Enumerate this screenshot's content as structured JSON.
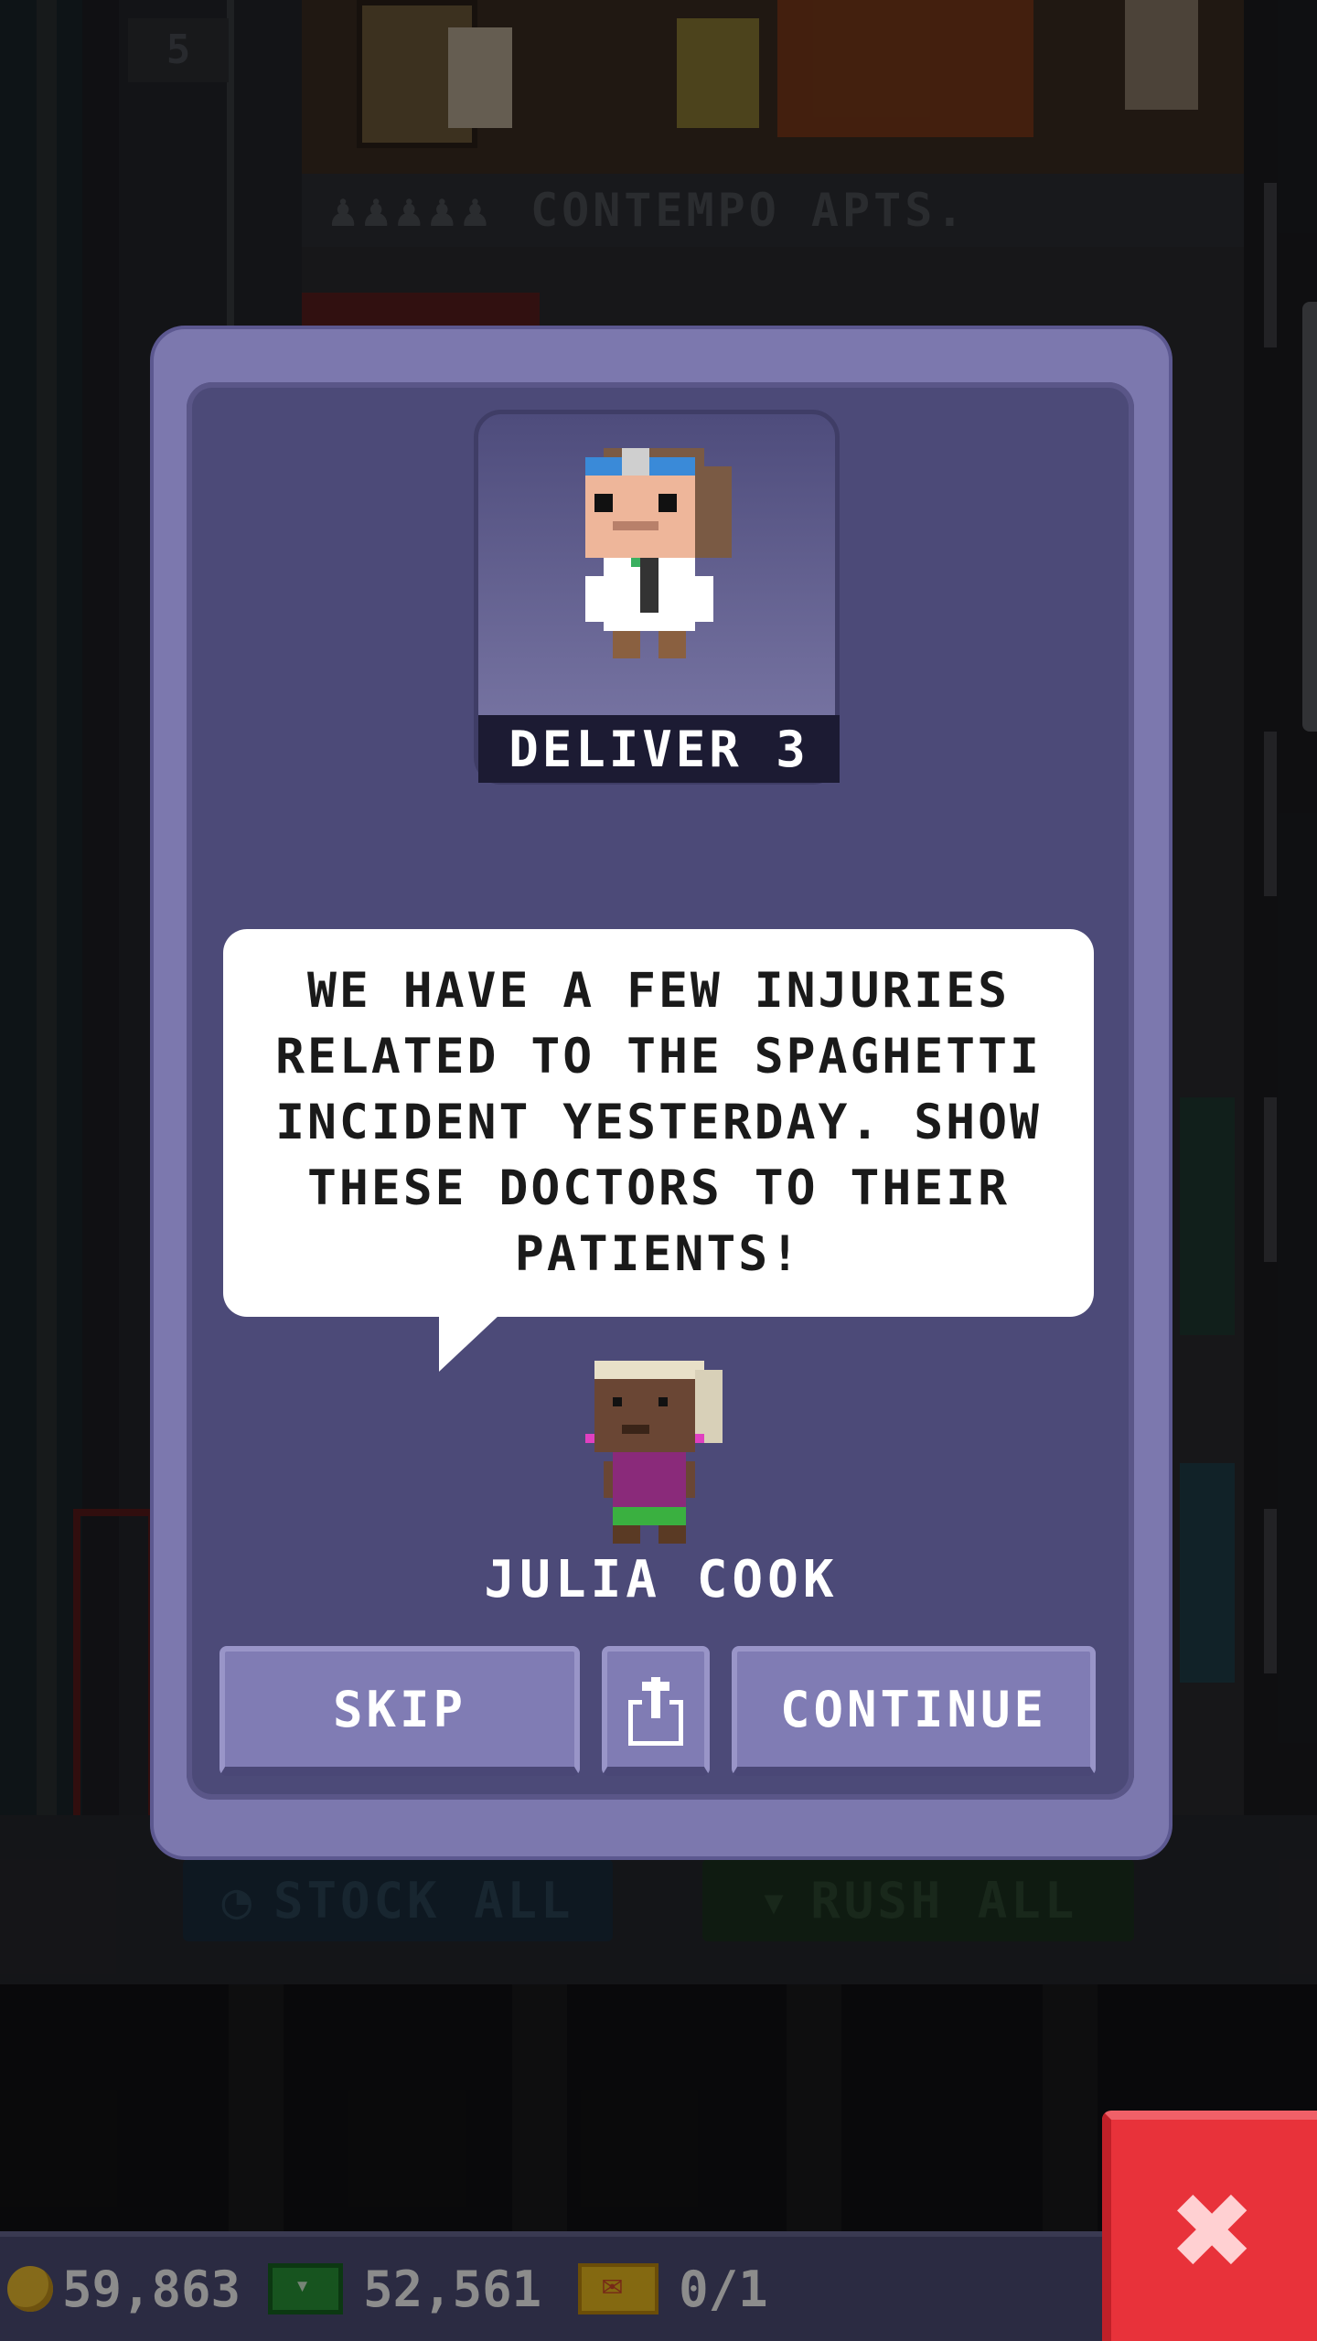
{
  "background": {
    "floor_number": "5",
    "floor_name": "CONTEMPO APTS.",
    "stock_all_label": "STOCK ALL",
    "rush_all_label": "RUSH ALL"
  },
  "dialog": {
    "task_label": "DELIVER 3",
    "message": "WE HAVE A FEW INJURIES RELATED TO THE SPAGHETTI INCIDENT YESTERDAY. SHOW THESE DOCTORS TO THEIR PATIENTS!",
    "speaker_name": "JULIA COOK",
    "buttons": {
      "skip": "SKIP",
      "continue": "CONTINUE"
    }
  },
  "currency": {
    "coins": "59,863",
    "bux": "52,561",
    "tickets": "0/1"
  },
  "colors": {
    "dialog_outer": "#7c78ae",
    "dialog_inner": "#4c4a78",
    "button": "#807cb4",
    "close_button": "#e8323a",
    "currency_bar": "#4f4f78"
  },
  "icons": {
    "share": "share-icon",
    "close": "close-icon",
    "coin": "coin-icon",
    "bux": "bux-icon",
    "ticket": "ticket-icon"
  }
}
